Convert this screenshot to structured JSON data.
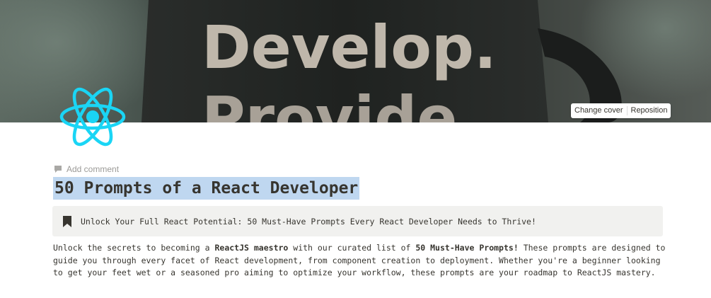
{
  "cover": {
    "image_text_line1": "Develop.",
    "image_text_line2": "Provide",
    "change_cover_label": "Change cover",
    "reposition_label": "Reposition"
  },
  "page_icon": {
    "name": "react-logo-icon",
    "color": "#1ad5f5"
  },
  "add_comment": {
    "icon": "comment-icon",
    "label": "Add comment"
  },
  "title": "50 Prompts of a React Developer",
  "callout": {
    "icon": "bookmark-icon",
    "text": "Unlock Your Full React Potential: 50 Must-Have Prompts Every React Developer Needs to Thrive!"
  },
  "intro": {
    "part1": "Unlock the secrets to becoming a ",
    "bold1": "ReactJS maestro",
    "part2": " with our curated list of ",
    "bold2": "50 Must-Have Prompts!",
    "part3": " These prompts are designed to guide you through every facet of React development, from component creation to deployment. Whether you're a beginner looking to get your feet wet or a seasoned pro aiming to optimize your workflow, these prompts are your roadmap to ReactJS mastery."
  },
  "colors": {
    "title_highlight": "#bfd7f0",
    "callout_background": "#f1f1ef",
    "text": "#37352f",
    "muted": "#9b9a97"
  }
}
